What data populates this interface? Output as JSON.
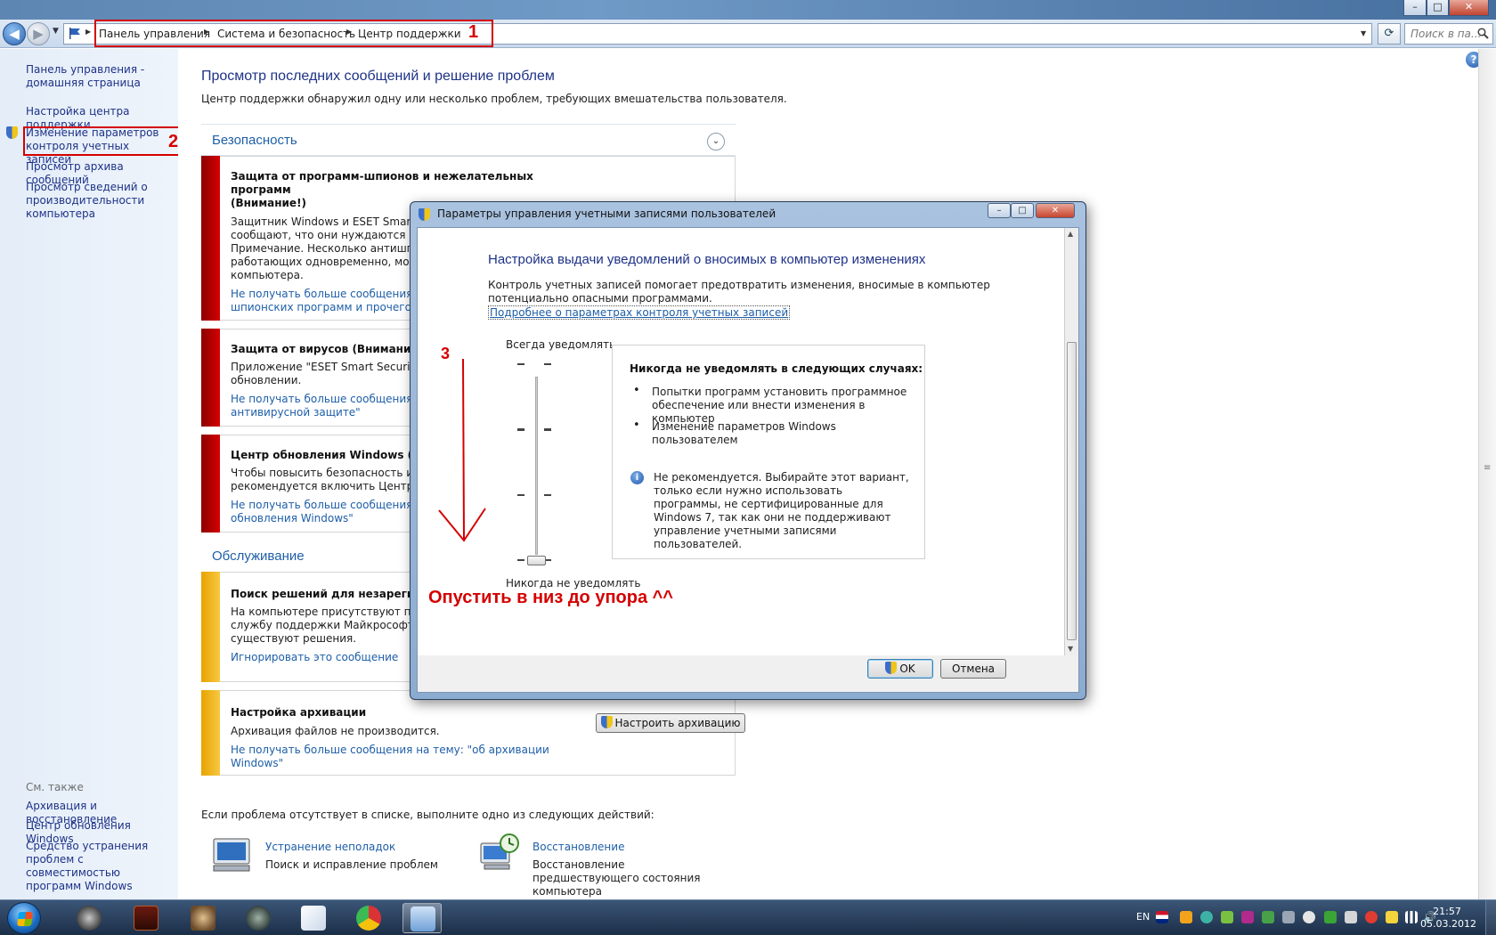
{
  "window": {
    "minimize": "–",
    "maximize": "□",
    "close": "✕"
  },
  "address_bar": {
    "crumbs": [
      "Панель управления",
      "Система и безопасность",
      "Центр поддержки"
    ],
    "search_placeholder": "Поиск в па..."
  },
  "annotations": {
    "marker1": "1",
    "marker2": "2",
    "marker3": "3",
    "instruction": "Опустить в низ до упора ^^",
    "color": "#d40000"
  },
  "sidebar": {
    "items": [
      "Панель управления - домашняя страница",
      "Настройка центра поддержки",
      "Изменение параметров контроля учетных записей",
      "Просмотр архива сообщений",
      "Просмотр сведений о производительности компьютера"
    ],
    "see_also_label": "См. также",
    "see_also": [
      "Архивация и восстановление",
      "Центр обновления Windows",
      "Средство устранения проблем с совместимостью программ Windows"
    ]
  },
  "main": {
    "title": "Просмотр последних сообщений и решение проблем",
    "subtitle": "Центр поддержки обнаружил одну или несколько проблем, требующих вмешательства пользователя.",
    "security_section": "Безопасность",
    "maintenance_section": "Обслуживание",
    "security_messages": [
      {
        "title1": "Защита от программ-шпионов и нежелательных",
        "title2": "программ",
        "title3": "(Внимание!)",
        "text1": "Защитник Windows и ESET Smart Sec",
        "text2": "сообщают, что они нуждаются в обн",
        "text3": "Примечание. Несколько антишпион",
        "text4": "работающих одновременно, могут з",
        "text5": "компьютера.",
        "link1": "Не получать больше сообщения на",
        "link2": "шпионских программ и прочего вре"
      },
      {
        "title1": "Защита от вирусов  (Внимание!)",
        "text1": "Приложение \"ESET Smart Security 5.0",
        "text2": "обновлении.",
        "link1": "Не получать больше сообщения на",
        "link2": "антивирусной защите\""
      },
      {
        "title1": "Центр обновления Windows  (Вним",
        "text1": "Чтобы повысить безопасность и про",
        "text2": "рекомендуется включить Центр обн",
        "link1": "Не получать больше сообщения на",
        "link2": "обновления Windows\""
      }
    ],
    "maintenance_messages": [
      {
        "title1": "Поиск решений для незарегистри",
        "text1": "На компьютере присутствуют пробл",
        "text2": "службу поддержки Майкрософт. Воз",
        "text3": "существуют решения.",
        "link1": "Игнорировать это сообщение"
      },
      {
        "title1": "Настройка архивации",
        "text1": "Архивация файлов не производится.",
        "link1": "Не получать больше сообщения на тему: \"об архивации",
        "link2": "Windows\"",
        "button": "Настроить архивацию"
      }
    ],
    "bottom_text": "Если проблема отсутствует в списке, выполните одно из следующих действий:",
    "troubleshoot_link": "Устранение неполадок",
    "troubleshoot_desc": "Поиск и исправление проблем",
    "restore_link": "Восстановление",
    "restore_desc1": "Восстановление",
    "restore_desc2": "предшествующего состояния",
    "restore_desc3": "компьютера"
  },
  "dialog": {
    "title": "Параметры управления учетными записями пользователей",
    "heading": "Настройка выдачи уведомлений о вносимых в компьютер изменениях",
    "description": "Контроль учетных записей помогает предотвратить изменения, вносимые в компьютер потенциально опасными программами.",
    "link": "Подробнее о параметрах контроля учетных записей",
    "slider_top_label": "Всегда уведомлять",
    "slider_bottom_label": "Никогда не уведомлять",
    "slider_level": 0,
    "slider_levels": 4,
    "info_heading": "Никогда не уведомлять в следующих случаях:",
    "bullet1": "Попытки программ установить программное обеспечение или внести изменения в компьютер",
    "bullet2": "Изменение параметров Windows пользователем",
    "note": "Не рекомендуется. Выбирайте этот вариант, только если нужно использовать программы, не сертифицированные для Windows 7, так как они не поддерживают управление учетными записями пользователей.",
    "ok_label": "OK",
    "cancel_label": "Отмена"
  },
  "taskbar": {
    "lang": "EN",
    "time": "21:57",
    "date": "05.03.2012"
  }
}
